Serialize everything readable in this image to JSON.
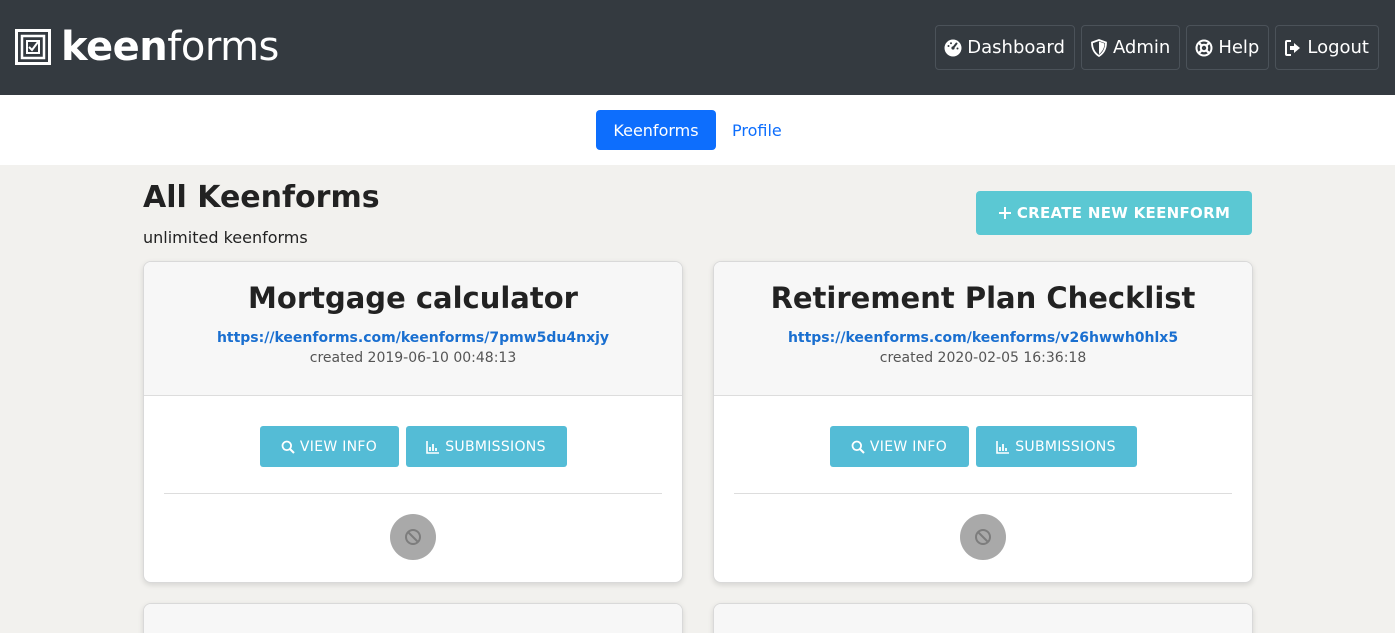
{
  "brand": {
    "bold": "keen",
    "light": "forms"
  },
  "topnav": [
    {
      "label": "Dashboard",
      "icon": "dashboard-icon"
    },
    {
      "label": "Admin",
      "icon": "shield-icon"
    },
    {
      "label": "Help",
      "icon": "lifebuoy-icon"
    },
    {
      "label": "Logout",
      "icon": "logout-icon"
    }
  ],
  "subnav": {
    "active": "Keenforms",
    "link": "Profile"
  },
  "page": {
    "title": "All Keenforms",
    "subtitle": "unlimited keenforms",
    "create_label": "CREATE NEW KEENFORM"
  },
  "cards": [
    {
      "title": "Mortgage calculator",
      "url": "https://keenforms.com/keenforms/7pmw5du4nxjy",
      "created": "created 2019-06-10 00:48:13",
      "view_label": "VIEW INFO",
      "subs_label": "SUBMISSIONS"
    },
    {
      "title": "Retirement Plan Checklist",
      "url": "https://keenforms.com/keenforms/v26hwwh0hlx5",
      "created": "created 2020-02-05 16:36:18",
      "view_label": "VIEW INFO",
      "subs_label": "SUBMISSIONS"
    }
  ],
  "colors": {
    "topbar": "#343a40",
    "primary": "#0d6efd",
    "create": "#5bc8d3",
    "action": "#54bcd6",
    "disabled": "#a9a9a9"
  }
}
